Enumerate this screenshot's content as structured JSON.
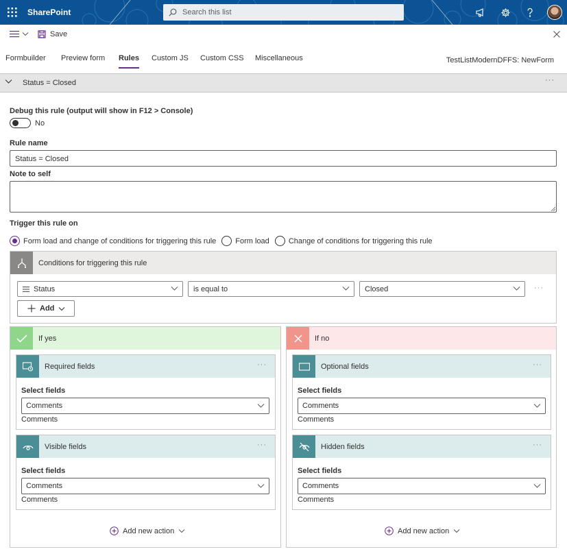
{
  "suitebar": {
    "brand": "SharePoint",
    "search_placeholder": "Search this list",
    "icons": [
      "waffle-icon",
      "search-icon",
      "megaphone-icon",
      "gear-icon",
      "help-icon",
      "avatar"
    ]
  },
  "commandbar": {
    "save_label": "Save"
  },
  "tabs": [
    {
      "label": "Formbuilder"
    },
    {
      "label": "Preview form"
    },
    {
      "label": "Rules",
      "active": true
    },
    {
      "label": "Custom JS"
    },
    {
      "label": "Custom CSS"
    },
    {
      "label": "Miscellaneous"
    }
  ],
  "form_name": "TestListModernDFFS: NewForm",
  "rule": {
    "header_title": "Status = Closed",
    "debug_label": "Debug this rule (output will show in F12 > Console)",
    "debug_value": "No",
    "name_label": "Rule name",
    "name_value": "Status = Closed",
    "note_label": "Note to self",
    "note_value": "",
    "trigger_label": "Trigger this rule on",
    "trigger_options": [
      {
        "label": "Form load and change of conditions for triggering this rule",
        "selected": true
      },
      {
        "label": "Form load",
        "selected": false
      },
      {
        "label": "Change of conditions for triggering this rule",
        "selected": false
      }
    ]
  },
  "conditions": {
    "title": "Conditions for triggering this rule",
    "field": "Status",
    "operator": "is equal to",
    "value": "Closed",
    "add_label": "Add"
  },
  "if_yes": {
    "title": "If yes",
    "color": "#dff6dd",
    "actions": [
      {
        "title": "Required fields",
        "select_label": "Select fields",
        "selected": "Comments",
        "value": "Comments"
      },
      {
        "title": "Visible fields",
        "select_label": "Select fields",
        "selected": "Comments",
        "value": "Comments"
      }
    ],
    "add_new_label": "Add new action"
  },
  "if_no": {
    "title": "If no",
    "color": "#fde7e9",
    "actions": [
      {
        "title": "Optional fields",
        "select_label": "Select fields",
        "selected": "Comments",
        "value": "Comments"
      },
      {
        "title": "Hidden fields",
        "select_label": "Select fields",
        "selected": "Comments",
        "value": "Comments"
      }
    ],
    "add_new_label": "Add new action"
  },
  "colors": {
    "accent": "#6b2e8c",
    "suitebar": "#0b5394",
    "action_icon": "#4c8e95"
  }
}
